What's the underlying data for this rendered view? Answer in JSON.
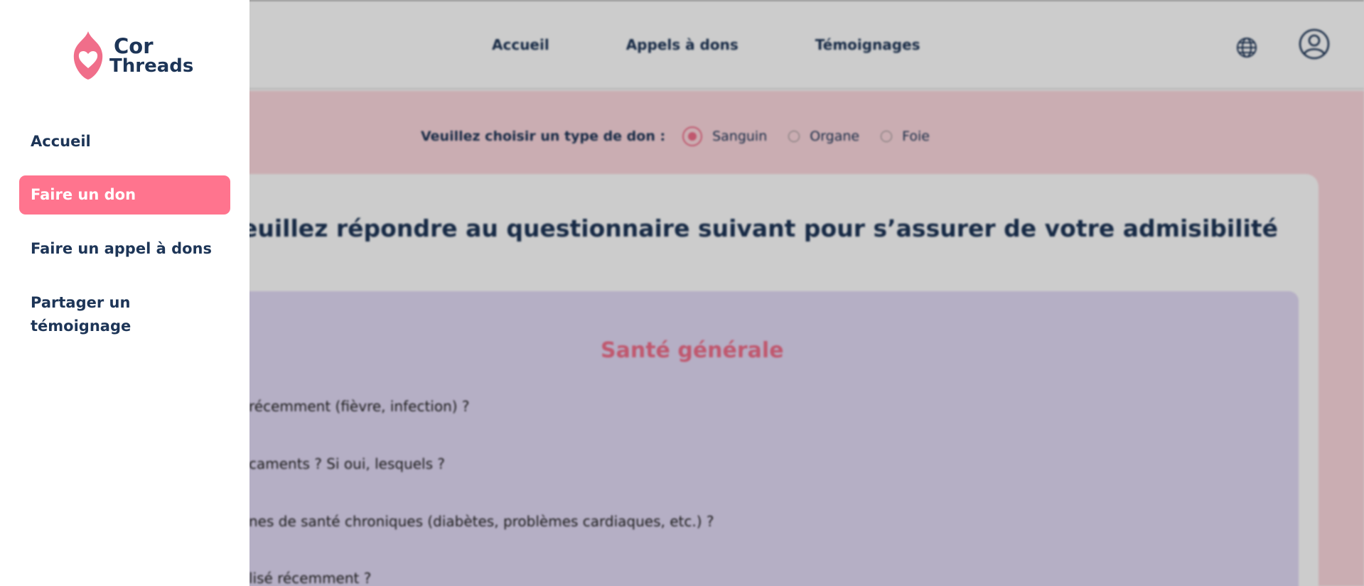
{
  "brand": {
    "line1": "Cor",
    "line2": "Threads",
    "accent": "#f06e8a"
  },
  "header": {
    "nav": [
      "Accueil",
      "Appels à dons",
      "Témoignages"
    ],
    "icons": [
      "globe-icon",
      "user-profile-icon"
    ]
  },
  "donation_type": {
    "question": "Veuillez choisir un type de don :",
    "options": [
      {
        "label": "Sanguin",
        "selected": true
      },
      {
        "label": "Organe",
        "selected": false
      },
      {
        "label": "Foie",
        "selected": false
      }
    ]
  },
  "form": {
    "title": "euillez répondre au questionnaire suivant pour s’assurer de votre admisibilité",
    "section_title": "Santé générale",
    "questions": [
      "récemment (fièvre, infection) ?",
      "caments ? Si oui, lesquels ?",
      "nes de santé chroniques (diabètes, problèmes cardiaques, etc.) ?",
      "lisé récemment ?"
    ]
  },
  "drawer": {
    "items": [
      {
        "label": "Accueil",
        "active": false
      },
      {
        "label": "Faire un don",
        "active": true
      },
      {
        "label": "Faire un appel à dons",
        "active": false
      },
      {
        "label": "Partager un témoignage",
        "active": false
      }
    ]
  }
}
